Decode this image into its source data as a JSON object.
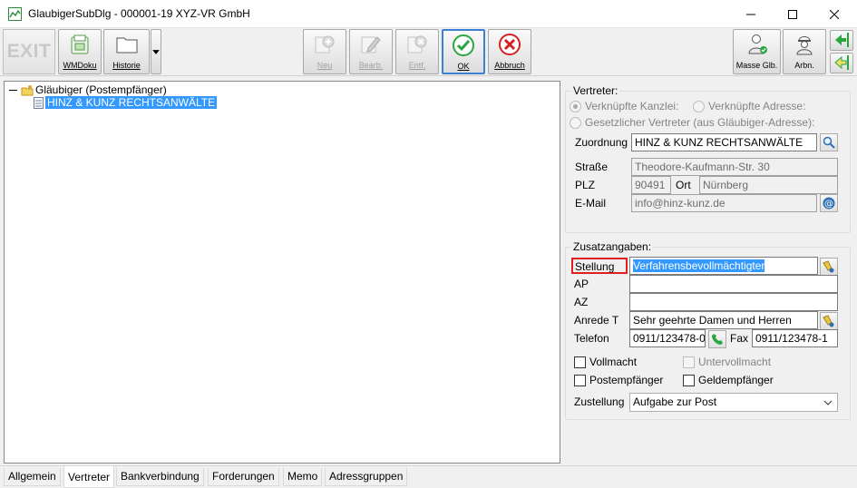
{
  "window": {
    "title": "GlaubigerSubDlg - 000001-19 XYZ-VR GmbH"
  },
  "toolbar": {
    "exit_label": "EXIT",
    "wmdoku_label": "WMDoku",
    "historie_label": "Historie",
    "neu_label": "Neu",
    "bearb_label": "Bearb.",
    "entf_label": "Entf.",
    "ok_label": "OK",
    "abbruch_label": "Abbruch",
    "masse_label": "Masse Glb.",
    "arbn_label": "Arbn."
  },
  "tree": {
    "root_label": "Gläubiger (Postempfänger)",
    "child_label": "HINZ & KUNZ RECHTSANWÄLTE"
  },
  "vertreter": {
    "legend": "Vertreter:",
    "radio_kanzlei": "Verknüpfte Kanzlei:",
    "radio_adresse": "Verknüpfte Adresse:",
    "radio_gesetzlich": "Gesetzlicher Vertreter (aus Gläubiger-Adresse):",
    "zuordnung_label": "Zuordnung",
    "zuordnung_value": "HINZ & KUNZ RECHTSANWÄLTE",
    "strasse_label": "Straße",
    "strasse_value": "Theodore-Kaufmann-Str. 30",
    "plz_label": "PLZ",
    "plz_value": "90491",
    "ort_label": "Ort",
    "ort_value": "Nürnberg",
    "email_label": "E-Mail",
    "email_value": "info@hinz-kunz.de"
  },
  "zusatz": {
    "legend": "Zusatzangaben:",
    "stellung_label": "Stellung",
    "stellung_value": "Verfahrensbevollmächtigter",
    "ap_label": "AP",
    "ap_value": "",
    "az_label": "AZ",
    "az_value": "",
    "anrede_label": "Anrede T",
    "anrede_value": "Sehr geehrte Damen und Herren",
    "telefon_label": "Telefon",
    "telefon_value": "0911/123478-0",
    "fax_label": "Fax",
    "fax_value": "0911/123478-1",
    "vollmacht_label": "Vollmacht",
    "untervollmacht_label": "Untervollmacht",
    "postempfaenger_label": "Postempfänger",
    "geldempfaenger_label": "Geldempfänger",
    "zustellung_label": "Zustellung",
    "zustellung_value": "Aufgabe zur Post"
  },
  "tabs": [
    "Allgemein",
    "Vertreter",
    "Bankverbindung",
    "Forderungen",
    "Memo",
    "Adressgruppen"
  ],
  "active_tab": "Vertreter",
  "colors": {
    "selection": "#3399ff",
    "ok_green": "#2aa640",
    "cancel_red": "#d42020",
    "stellung_border": "#e02020"
  }
}
